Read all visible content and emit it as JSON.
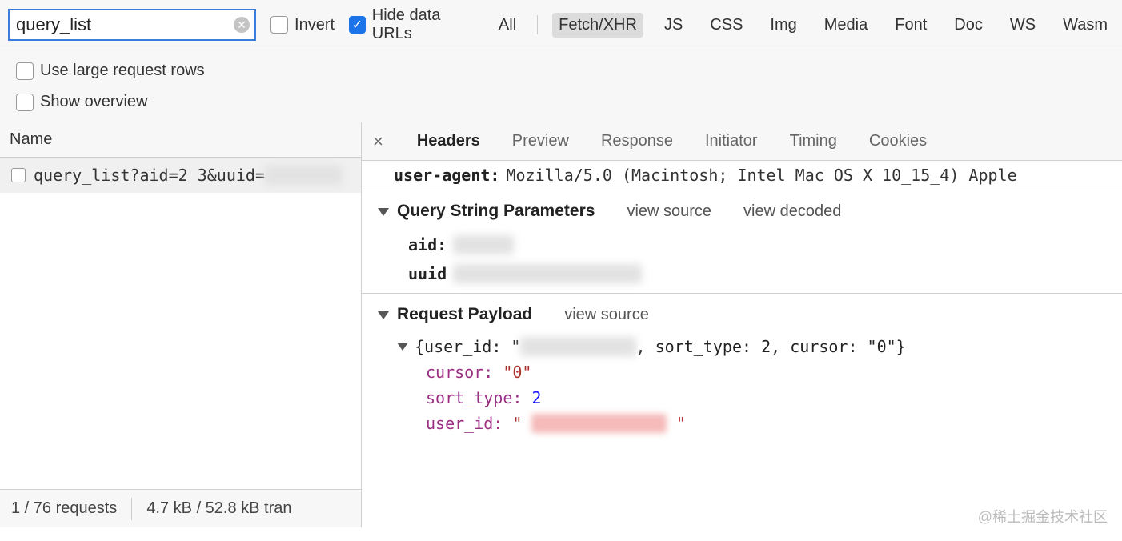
{
  "filter": {
    "value": "query_list",
    "invert_label": "Invert",
    "hide_urls_label": "Hide data URLs"
  },
  "types": {
    "all": "All",
    "fetch": "Fetch/XHR",
    "js": "JS",
    "css": "CSS",
    "img": "Img",
    "media": "Media",
    "font": "Font",
    "doc": "Doc",
    "ws": "WS",
    "wasm": "Wasm"
  },
  "options": {
    "large_rows": "Use large request rows",
    "overview": "Show overview"
  },
  "name_header": "Name",
  "request_row_text": "query_list?aid=2    3&uuid=",
  "status": {
    "requests": "1 / 76 requests",
    "transfer": "4.7 kB / 52.8 kB tran"
  },
  "tabs": {
    "headers": "Headers",
    "preview": "Preview",
    "response": "Response",
    "initiator": "Initiator",
    "timing": "Timing",
    "cookies": "Cookies"
  },
  "headers_pane": {
    "ua_key": "user-agent:",
    "ua_val": "Mozilla/5.0 (Macintosh; Intel Mac OS X 10_15_4) Apple"
  },
  "qsp": {
    "title": "Query String Parameters",
    "view_source": "view source",
    "view_decoded": "view decoded",
    "aid_key": "aid:",
    "uuid_key": "uuid"
  },
  "payload": {
    "title": "Request Payload",
    "view_source": "view source",
    "summary_prefix": "{user_id: \"",
    "summary_suffix": ", sort_type: 2, cursor: \"0\"}",
    "cursor_key": "cursor:",
    "cursor_val": "\"0\"",
    "sort_key": "sort_type:",
    "sort_val": "2",
    "user_key": "user_id:",
    "user_val_quote": "\""
  },
  "watermark": "@稀土掘金技术社区"
}
